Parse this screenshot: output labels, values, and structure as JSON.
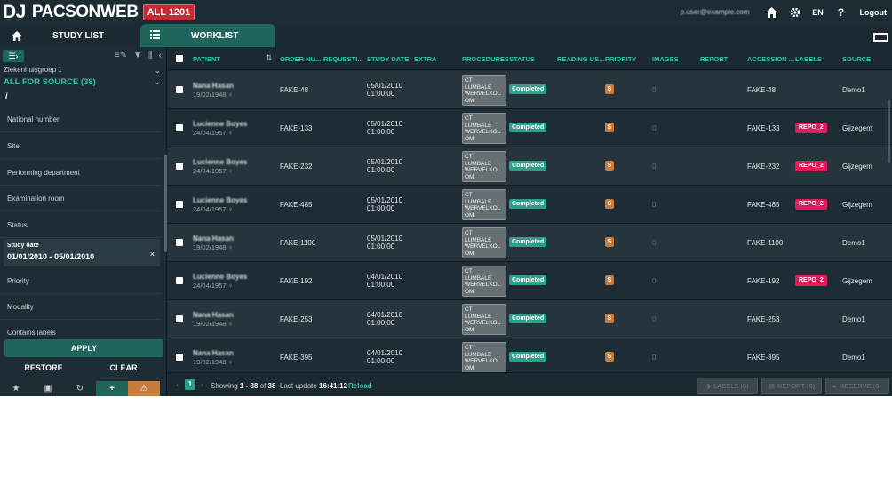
{
  "header": {
    "logo_dj": "DJ",
    "logo_text": "PACSONWEB",
    "environment_badge": "ALL 1201",
    "user_email": "p.user@example.com",
    "language": "EN",
    "logout": "Logout"
  },
  "tabs": {
    "study_list": "STUDY LIST",
    "worklist": "WORKLIST"
  },
  "sidebar": {
    "group": "Ziekenhuisgroep 1",
    "source": "ALL FOR SOURCE (38)",
    "info": "i",
    "filters": [
      "National number",
      "Site",
      "Performing department",
      "Examination room",
      "Status"
    ],
    "active_filter": {
      "label": "Study date",
      "value": "01/01/2010 - 05/01/2010"
    },
    "filters_after": [
      "Priority",
      "Modality",
      "Contains labels"
    ],
    "apply": "APPLY",
    "restore": "RESTORE",
    "clear": "CLEAR"
  },
  "table": {
    "columns": [
      "PATIENT",
      "ORDER NU...",
      "REQUESTI...",
      "STUDY DATE",
      "EXTRA",
      "PROCEDURES",
      "STATUS",
      "READING US...",
      "PRIORITY",
      "IMAGES",
      "REPORT",
      "ACCESSION ...",
      "LABELS",
      "SOURCE"
    ],
    "rows": [
      {
        "patient": "Nana Hasan",
        "dob": "19/02/1948 ♀",
        "order": "FAKE-48",
        "date": "05/01/2010",
        "time": "01:00:00",
        "proc": [
          "CT",
          "LUMBALE",
          "WERVELKOL",
          "OM"
        ],
        "status": "Completed",
        "priority": "S",
        "images": "0",
        "accession": "FAKE-48",
        "label": "",
        "source": "Demo1"
      },
      {
        "patient": "Lucienne Boyes",
        "dob": "24/04/1957 ♀",
        "order": "FAKE-133",
        "date": "05/01/2010",
        "time": "01:00:00",
        "proc": [
          "CT",
          "LUMBALE",
          "WERVELKOL",
          "OM"
        ],
        "status": "Completed",
        "priority": "S",
        "images": "0",
        "accession": "FAKE-133",
        "label": "REPO_2",
        "source": "Gijzegem"
      },
      {
        "patient": "Lucienne Boyes",
        "dob": "24/04/1957 ♀",
        "order": "FAKE-232",
        "date": "05/01/2010",
        "time": "01:00:00",
        "proc": [
          "CT",
          "LUMBALE",
          "WERVELKOL",
          "OM"
        ],
        "status": "Completed",
        "priority": "S",
        "images": "0",
        "accession": "FAKE-232",
        "label": "REPO_2",
        "source": "Gijzegem"
      },
      {
        "patient": "Lucienne Boyes",
        "dob": "24/04/1957 ♀",
        "order": "FAKE-485",
        "date": "05/01/2010",
        "time": "01:00:00",
        "proc": [
          "CT",
          "LUMBALE",
          "WERVELKOL",
          "OM"
        ],
        "status": "Completed",
        "priority": "S",
        "images": "0",
        "accession": "FAKE-485",
        "label": "REPO_2",
        "source": "Gijzegem"
      },
      {
        "patient": "Nana Hasan",
        "dob": "19/02/1948 ♀",
        "order": "FAKE-1100",
        "date": "05/01/2010",
        "time": "01:00:00",
        "proc": [
          "CT",
          "LUMBALE",
          "WERVELKOL",
          "OM"
        ],
        "status": "Completed",
        "priority": "S",
        "images": "0",
        "accession": "FAKE-1100",
        "label": "",
        "source": "Demo1"
      },
      {
        "patient": "Lucienne Boyes",
        "dob": "24/04/1957 ♀",
        "order": "FAKE-192",
        "date": "04/01/2010",
        "time": "01:00:00",
        "proc": [
          "CT",
          "LUMBALE",
          "WERVELKOL",
          "OM"
        ],
        "status": "Completed",
        "priority": "S",
        "images": "0",
        "accession": "FAKE-192",
        "label": "REPO_2",
        "source": "Gijzegem"
      },
      {
        "patient": "Nana Hasan",
        "dob": "19/02/1948 ♀",
        "order": "FAKE-253",
        "date": "04/01/2010",
        "time": "01:00:00",
        "proc": [
          "CT",
          "LUMBALE",
          "WERVELKOL",
          "OM"
        ],
        "status": "Completed",
        "priority": "S",
        "images": "0",
        "accession": "FAKE-253",
        "label": "",
        "source": "Demo1"
      },
      {
        "patient": "Nana Hasan",
        "dob": "19/02/1948 ♀",
        "order": "FAKE-395",
        "date": "04/01/2010",
        "time": "01:00:00",
        "proc": [
          "CT",
          "LUMBALE",
          "WERVELKOL",
          "OM"
        ],
        "status": "Completed",
        "priority": "S",
        "images": "0",
        "accession": "FAKE-395",
        "label": "",
        "source": "Demo1"
      }
    ]
  },
  "footer": {
    "page": "1",
    "showing_prefix": "Showing ",
    "showing_range": "1 - 38",
    "showing_of": " of ",
    "total": "38",
    "last_update_label": "Last update ",
    "last_update_time": "16:41:12",
    "reload": "Reload",
    "labels_button": "LABELS (0)",
    "report_button": "REPORT (0)",
    "reserve_button": "RESERVE (0)"
  },
  "colors": {
    "accent": "#2fc3a6",
    "tab_active": "#20655c",
    "status_completed": "#2aa08a",
    "priority": "#c87c3c",
    "label": "#e2195b",
    "env_badge": "#c62a35"
  }
}
